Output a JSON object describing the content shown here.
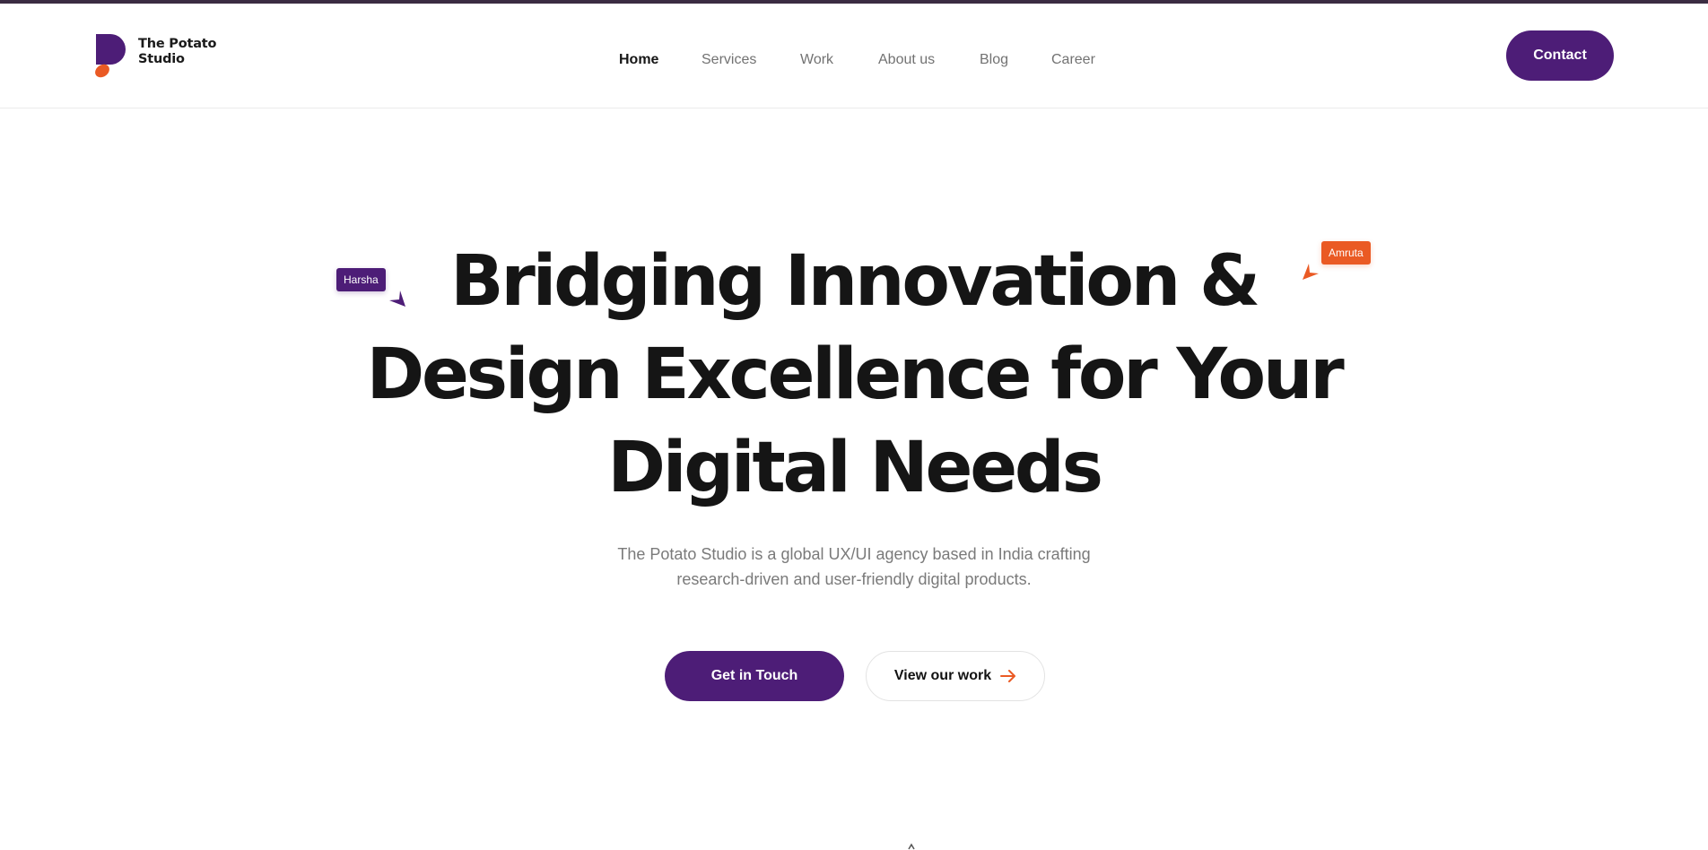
{
  "brand": {
    "name_line1": "The Potato",
    "name_line2": "Studio",
    "primary_color": "#4d1d77",
    "accent_color": "#ea5a24"
  },
  "nav": {
    "items": [
      {
        "label": "Home",
        "active": true
      },
      {
        "label": "Services",
        "active": false
      },
      {
        "label": "Work",
        "active": false
      },
      {
        "label": "About us",
        "active": false
      },
      {
        "label": "Blog",
        "active": false
      },
      {
        "label": "Career",
        "active": false
      }
    ],
    "contact_label": "Contact"
  },
  "hero": {
    "title_lines": [
      "Bridging Innovation &",
      "Design Excellence for Your",
      "Digital Needs"
    ],
    "subtitle_lines": [
      "The Potato Studio is a global UX/UI agency based in India crafting",
      "research-driven and user-friendly digital products."
    ],
    "primary_cta": "Get in Touch",
    "secondary_cta": "View our work",
    "secondary_cta_icon": "arrow-right-icon"
  },
  "cursors": [
    {
      "name": "Harsha",
      "color": "#4d1d77"
    },
    {
      "name": "Amruta",
      "color": "#ea5a24"
    }
  ]
}
